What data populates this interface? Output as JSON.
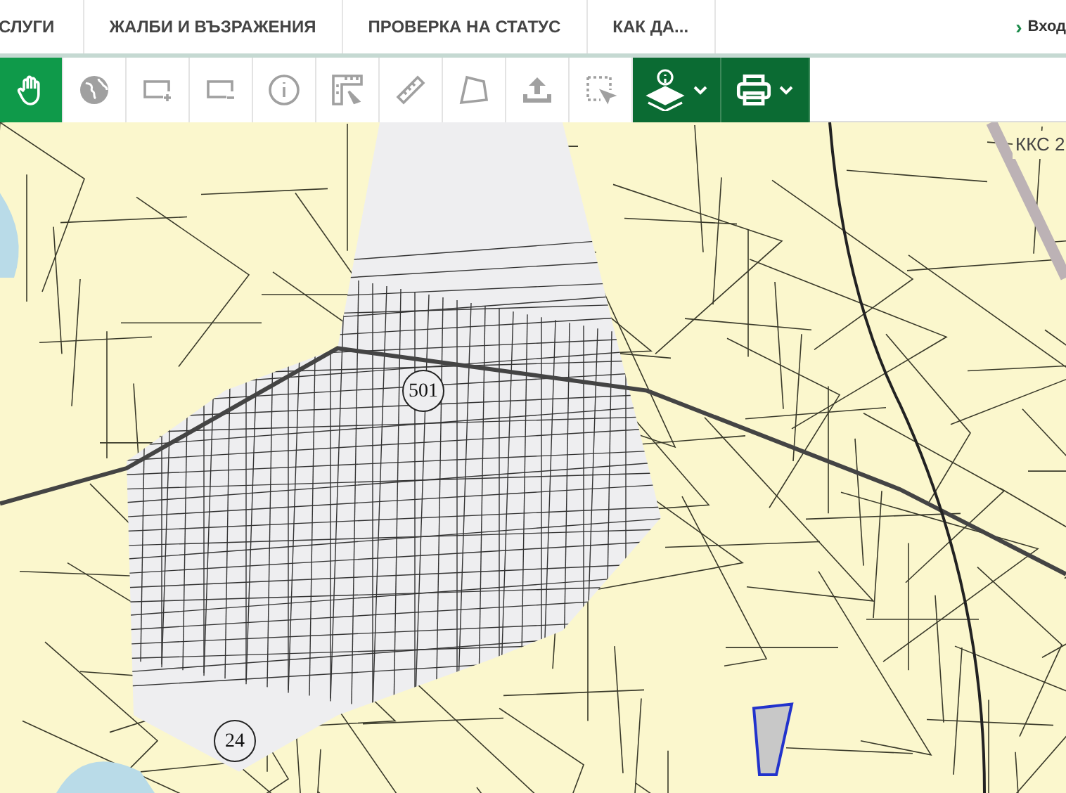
{
  "nav": {
    "items": [
      {
        "label": "СЛУГИ"
      },
      {
        "label": "ЖАЛБИ И ВЪЗРАЖЕНИЯ"
      },
      {
        "label": "ПРОВЕРКА НА СТАТУС"
      },
      {
        "label": "КАК ДА..."
      }
    ],
    "login": {
      "arrow": "›",
      "label": "Вход"
    }
  },
  "toolbar": {
    "tools": [
      {
        "kind": "pan",
        "selected": true
      },
      {
        "kind": "globe",
        "selected": false
      },
      {
        "kind": "zoom-in",
        "selected": false
      },
      {
        "kind": "zoom-out",
        "selected": false
      },
      {
        "kind": "info",
        "selected": false
      },
      {
        "kind": "area",
        "selected": false
      },
      {
        "kind": "ruler",
        "selected": false
      },
      {
        "kind": "polygon",
        "selected": false
      },
      {
        "kind": "upload",
        "selected": false
      },
      {
        "kind": "select",
        "selected": false
      }
    ],
    "menus": [
      {
        "kind": "layers"
      },
      {
        "kind": "print"
      }
    ]
  },
  "map": {
    "labels": [
      {
        "kind": "circled",
        "text": "501"
      },
      {
        "kind": "circled",
        "text": "24"
      },
      {
        "kind": "plain",
        "text": "ККС 2"
      }
    ]
  }
}
